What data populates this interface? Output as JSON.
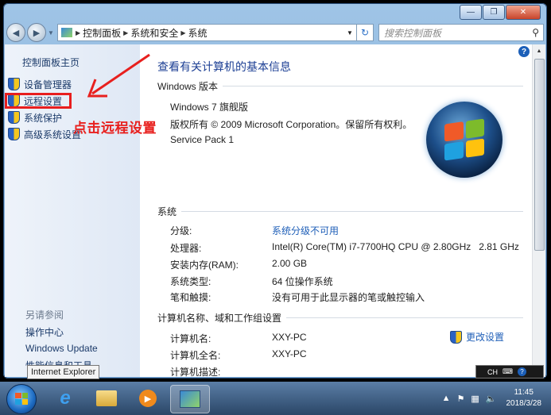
{
  "window": {
    "caption_minimize": "—",
    "caption_maximize": "❐",
    "caption_close": "✕"
  },
  "address": {
    "breadcrumbs": [
      "控制面板",
      "系统和安全",
      "系统"
    ],
    "search_placeholder": "搜索控制面板"
  },
  "sidebar": {
    "home": "控制面板主页",
    "items": [
      "设备管理器",
      "远程设置",
      "系统保护",
      "高级系统设置"
    ],
    "see_also_title": "另请参阅",
    "see_also": [
      "操作中心",
      "Windows Update",
      "性能信息和工具"
    ]
  },
  "annotation": "点击远程设置",
  "main": {
    "title": "查看有关计算机的基本信息",
    "edition_section": "Windows 版本",
    "edition": "Windows 7 旗舰版",
    "copyright": "版权所有 © 2009 Microsoft Corporation。保留所有权利。",
    "service_pack": "Service Pack 1",
    "system_section": "系统",
    "system_rows": [
      {
        "label": "分级:",
        "value": "系统分级不可用"
      },
      {
        "label": "处理器:",
        "value": "Intel(R) Core(TM) i7-7700HQ CPU @ 2.80GHz   2.81 GHz"
      },
      {
        "label": "安装内存(RAM):",
        "value": "2.00 GB"
      },
      {
        "label": "系统类型:",
        "value": "64 位操作系统"
      },
      {
        "label": "笔和触摸:",
        "value": "没有可用于此显示器的笔或触控输入"
      }
    ],
    "computer_section": "计算机名称、域和工作组设置",
    "computer_rows": [
      {
        "label": "计算机名:",
        "value": "XXY-PC"
      },
      {
        "label": "计算机全名:",
        "value": "XXY-PC"
      },
      {
        "label": "计算机描述:",
        "value": ""
      }
    ],
    "change_settings": "更改设置"
  },
  "tooltip": "Internet Explorer",
  "langbar": {
    "lang": "CH"
  },
  "taskbar": {
    "time": "11:45",
    "date": "2018/3/28"
  },
  "colors": {
    "annotation": "#e8201e",
    "link": "#1f5fb8",
    "title": "#1c3f94"
  }
}
